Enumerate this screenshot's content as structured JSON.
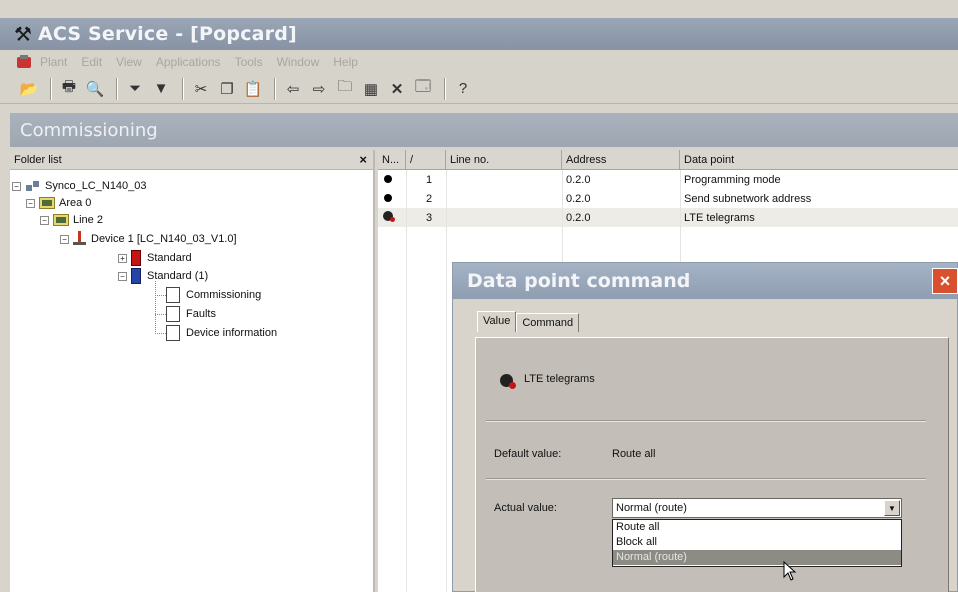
{
  "window": {
    "title": "ACS Service - [Popcard]",
    "app_icon": "tools-icon"
  },
  "menu": {
    "items": [
      "Plant",
      "Edit",
      "View",
      "Applications",
      "Tools",
      "Window",
      "Help"
    ]
  },
  "toolbar": {
    "icons": [
      "open-icon",
      "print-icon",
      "print-preview-icon",
      "filter-icon",
      "filter-active-icon",
      "cut-icon",
      "copy-icon",
      "paste-icon",
      "back-icon",
      "forward-icon",
      "up-folder-icon",
      "grid-view-icon",
      "delete-icon",
      "properties-icon",
      "help-icon"
    ]
  },
  "section": {
    "title": "Commissioning"
  },
  "folder_list": {
    "header": "Folder list",
    "close": "×",
    "tree": {
      "root": "Synco_LC_N140_03",
      "area": "Area 0",
      "line": "Line 2",
      "device": "Device 1 [LC_N140_03_V1.0]",
      "standard": "Standard",
      "standard1": "Standard (1)",
      "commissioning": "Commissioning",
      "faults": "Faults",
      "device_info": "Device information"
    }
  },
  "datapoints": {
    "columns": [
      "N...",
      "/",
      "Line no.",
      "Address",
      "Data point"
    ],
    "rows": [
      {
        "num": "1",
        "address": "0.2.0",
        "point": "Programming mode"
      },
      {
        "num": "2",
        "address": "0.2.0",
        "point": "Send subnetwork address"
      },
      {
        "num": "3",
        "address": "0.2.0",
        "point": "LTE telegrams"
      }
    ]
  },
  "dialog": {
    "title": "Data point command",
    "close": "×",
    "tabs": [
      "Value",
      "Command"
    ],
    "datapoint_label": "LTE telegrams",
    "default_label": "Default value:",
    "default_value": "Route all",
    "actual_label": "Actual value:",
    "actual_value": "Normal (route)",
    "options": [
      "Route all",
      "Block all",
      "Normal (route)"
    ]
  }
}
